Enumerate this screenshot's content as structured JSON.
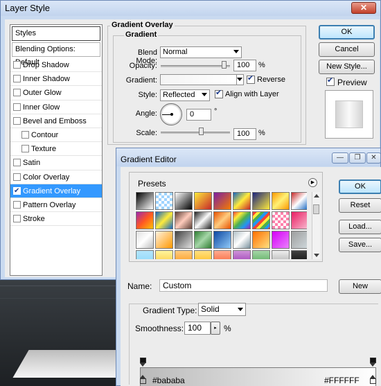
{
  "layer_style": {
    "title": "Layer Style",
    "close_glyph": "✕",
    "styles_header": "Styles",
    "blending_options": "Blending Options: Default",
    "items": [
      {
        "label": "Drop Shadow",
        "checked": false,
        "selected": false,
        "indent": false
      },
      {
        "label": "Inner Shadow",
        "checked": false,
        "selected": false,
        "indent": false
      },
      {
        "label": "Outer Glow",
        "checked": false,
        "selected": false,
        "indent": false
      },
      {
        "label": "Inner Glow",
        "checked": false,
        "selected": false,
        "indent": false
      },
      {
        "label": "Bevel and Emboss",
        "checked": false,
        "selected": false,
        "indent": false
      },
      {
        "label": "Contour",
        "checked": false,
        "selected": false,
        "indent": true
      },
      {
        "label": "Texture",
        "checked": false,
        "selected": false,
        "indent": true
      },
      {
        "label": "Satin",
        "checked": false,
        "selected": false,
        "indent": false
      },
      {
        "label": "Color Overlay",
        "checked": false,
        "selected": false,
        "indent": false
      },
      {
        "label": "Gradient Overlay",
        "checked": true,
        "selected": true,
        "indent": false
      },
      {
        "label": "Pattern Overlay",
        "checked": false,
        "selected": false,
        "indent": false
      },
      {
        "label": "Stroke",
        "checked": false,
        "selected": false,
        "indent": false
      }
    ],
    "panel": {
      "section_title": "Gradient Overlay",
      "group_title": "Gradient",
      "blend_mode_label": "Blend Mode:",
      "blend_mode_value": "Normal",
      "opacity_label": "Opacity:",
      "opacity_value": "100",
      "opacity_unit": "%",
      "gradient_label": "Gradient:",
      "reverse_label": "Reverse",
      "reverse_checked": true,
      "style_label": "Style:",
      "style_value": "Reflected",
      "align_label": "Align with Layer",
      "align_checked": true,
      "angle_label": "Angle:",
      "angle_value": "0",
      "angle_unit": "°",
      "scale_label": "Scale:",
      "scale_value": "100",
      "scale_unit": "%"
    },
    "buttons": {
      "ok": "OK",
      "cancel": "Cancel",
      "new_style": "New Style...",
      "preview": "Preview"
    },
    "preview_checked": true
  },
  "gradient_editor": {
    "title": "Gradient Editor",
    "presets_label": "Presets",
    "name_label": "Name:",
    "name_value": "Custom",
    "gradient_type_label": "Gradient Type:",
    "gradient_type_value": "Solid",
    "smoothness_label": "Smoothness:",
    "smoothness_value": "100",
    "smoothness_unit": "%",
    "stop_left_hex": "#bababa",
    "stop_right_hex": "#FFFFFF",
    "gradient_start_color": "#bababa",
    "gradient_end_color": "#ffffff",
    "buttons": {
      "ok": "OK",
      "reset": "Reset",
      "load": "Load...",
      "save": "Save...",
      "new": "New"
    },
    "window_controls": {
      "minimize": "—",
      "maximize": "❐",
      "close": "✕"
    },
    "preset_swatches": [
      "linear-gradient(135deg,#000 0%,#fff 100%)",
      "repeating-conic-gradient(#9fd4ff 0 25%,#fff 0 50%) 0 0/8px 8px",
      "linear-gradient(135deg,#fff 0%,#000 100%)",
      "linear-gradient(135deg,#ffeb3b 0%,#c62828 100%)",
      "linear-gradient(135deg,#7b1fa2 0%,#f57c00 100%)",
      "linear-gradient(135deg,#1565c0 0%,#ffeb3b 50%,#c62828 100%)",
      "linear-gradient(135deg,#1a237e 0%,#ffeb3b 100%)",
      "linear-gradient(135deg,#ff9800 0%,#fff176 50%,#ff9800 100%)",
      "linear-gradient(135deg,#c62828 0%,#ffffff 50%,#1565c0 100%)",
      "linear-gradient(135deg,#9c27b0 0%,#ff5722 50%,#ffc107 100%)",
      "linear-gradient(135deg,#1565c0 0%,#ffeb3b 50%,#1565c0 100%)",
      "linear-gradient(135deg,#5d4037 0%,#ffccbc 50%,#5d4037 100%)",
      "linear-gradient(135deg,#212121 0%,#fafafa 50%,#212121 100%)",
      "linear-gradient(135deg,#e65100 0%,#ffcc80 50%,#e65100 100%)",
      "linear-gradient(135deg,#f44336,#ffeb3b,#4caf50,#2196f3,#9c27b0)",
      "repeating-linear-gradient(135deg,#f44336 0 4px,#ffeb3b 4px 8px,#4caf50 8px 12px,#2196f3 12px 16px)",
      "repeating-conic-gradient(#ff80ab 0 25%,#fff 0 50%) 0 0/8px 8px",
      "linear-gradient(135deg,#e91e63 0%,#f8bbd0 100%)",
      "linear-gradient(135deg,#e0e0e0 0%,#ffffff 50%,#bdbdbd 100%)",
      "linear-gradient(135deg,#fff3e0 0%,#ff9800 100%)",
      "linear-gradient(135deg,#424242 0%,#e0e0e0 100%)",
      "linear-gradient(135deg,#2e7d32 0%,#a5d6a7 50%,#2e7d32 100%)",
      "linear-gradient(135deg,#0d47a1 0%,#90caf9 100%)",
      "linear-gradient(135deg,#b0bec5 0%,#ffffff 50%,#78909c 100%)",
      "linear-gradient(135deg,#ff6f00 0%,#ffe082 100%)",
      "linear-gradient(135deg,#d500f9 0%,#ea80fc 100%)",
      "linear-gradient(135deg,#9e9e9e 0%,#cfd8dc 100%)",
      "linear-gradient(180deg,#b3e5fc 0%,#81d4fa 100%)",
      "linear-gradient(180deg,#fff59d 0%,#fbc02d 100%)",
      "linear-gradient(180deg,#ffcc80 0%,#fb8c00 100%)",
      "linear-gradient(180deg,#ffe082 0%,#ffb300 100%)",
      "linear-gradient(180deg,#ffab91 0%,#f4511e 100%)",
      "linear-gradient(180deg,#ce93d8 0%,#8e24aa 100%)",
      "linear-gradient(180deg,#a5d6a7 0%,#43a047 100%)",
      "linear-gradient(180deg,#eeeeee 0%,#9e9e9e 100%)",
      "linear-gradient(180deg,#424242 0%,#000000 100%)"
    ]
  }
}
